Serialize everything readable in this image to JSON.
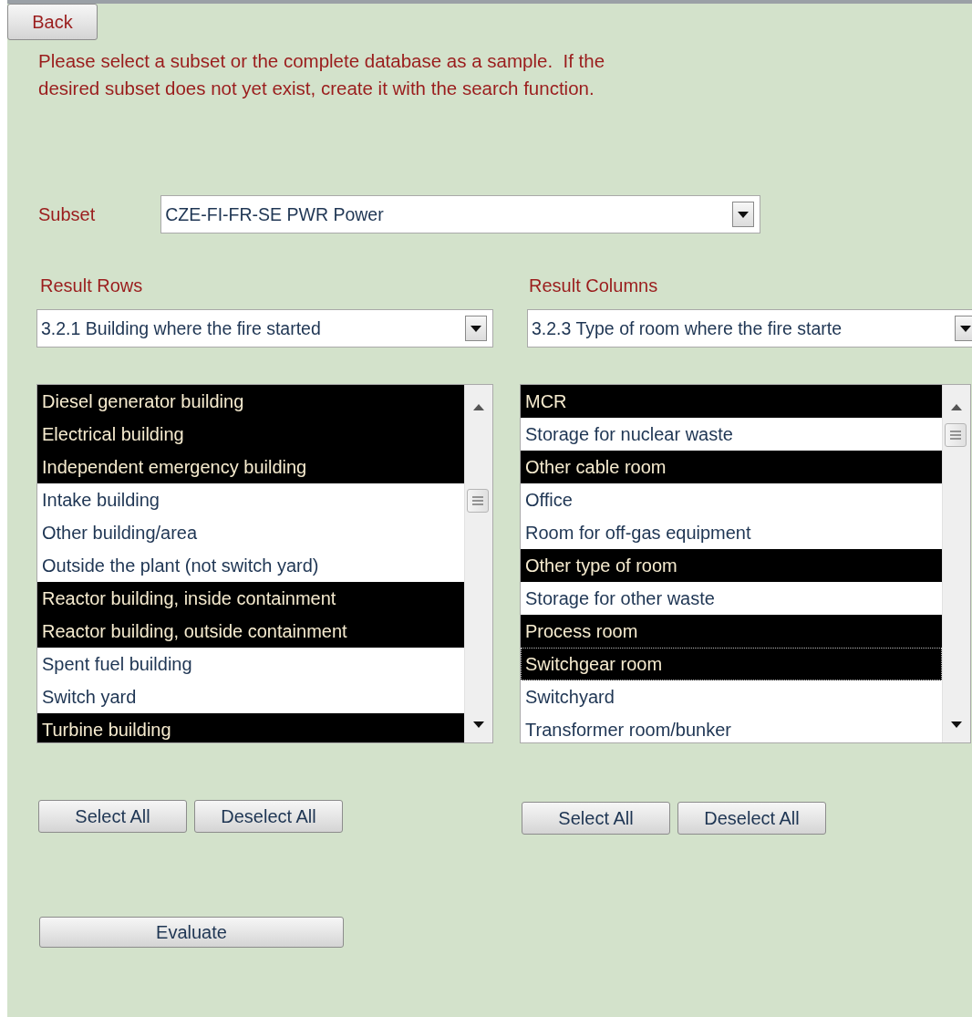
{
  "back_button": "Back",
  "instructions": "Please select a subset or the complete database as a sample.  If the\ndesired subset does not yet exist, create it with the search function.",
  "subset": {
    "label": "Subset",
    "value": "CZE-FI-FR-SE PWR Power"
  },
  "panels": [
    {
      "label": "Result Rows",
      "field": "3.2.1 Building where the fire started",
      "items": [
        {
          "text": "Diesel generator building",
          "selected": true,
          "focused": false
        },
        {
          "text": "Electrical building",
          "selected": true,
          "focused": false
        },
        {
          "text": "Independent emergency building",
          "selected": true,
          "focused": false
        },
        {
          "text": "Intake building",
          "selected": false,
          "focused": false
        },
        {
          "text": "Other building/area",
          "selected": false,
          "focused": false
        },
        {
          "text": "Outside the plant (not switch yard)",
          "selected": false,
          "focused": false
        },
        {
          "text": "Reactor building, inside containment",
          "selected": true,
          "focused": false
        },
        {
          "text": "Reactor building, outside containment",
          "selected": true,
          "focused": false
        },
        {
          "text": "Spent fuel building",
          "selected": false,
          "focused": false
        },
        {
          "text": "Switch yard",
          "selected": false,
          "focused": false
        },
        {
          "text": "Turbine building",
          "selected": true,
          "focused": false
        }
      ],
      "buttons": [
        "Select All",
        "Deselect All"
      ]
    },
    {
      "label": "Result Columns",
      "field": "3.2.3 Type of room where the fire starte",
      "items": [
        {
          "text": "MCR",
          "selected": true,
          "focused": false
        },
        {
          "text": "Storage for nuclear waste",
          "selected": false,
          "focused": false
        },
        {
          "text": "Other cable room",
          "selected": true,
          "focused": false
        },
        {
          "text": "Office",
          "selected": false,
          "focused": false
        },
        {
          "text": "Room for off-gas equipment",
          "selected": false,
          "focused": false
        },
        {
          "text": "Other type of room",
          "selected": true,
          "focused": false
        },
        {
          "text": "Storage for other waste",
          "selected": false,
          "focused": false
        },
        {
          "text": "Process room",
          "selected": true,
          "focused": false
        },
        {
          "text": "Switchgear room",
          "selected": true,
          "focused": true
        },
        {
          "text": "Switchyard",
          "selected": false,
          "focused": false
        },
        {
          "text": "Transformer room/bunker",
          "selected": false,
          "focused": false
        }
      ],
      "buttons": [
        "Select All",
        "Deselect All"
      ]
    }
  ],
  "evaluate_button": "Evaluate"
}
